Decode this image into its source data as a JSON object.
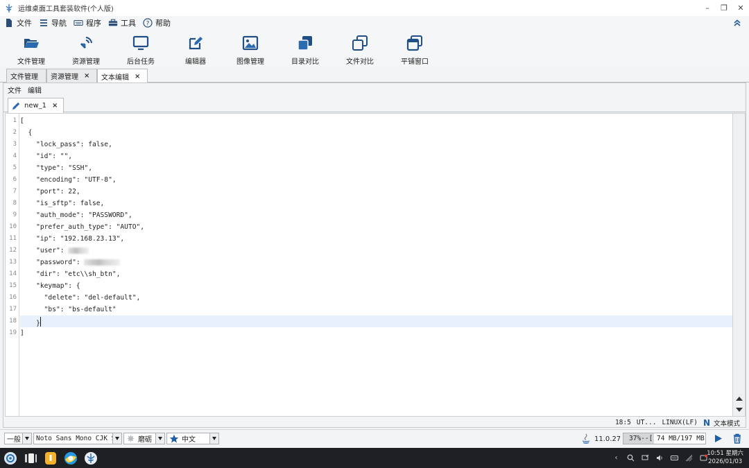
{
  "window": {
    "title": "运维桌面工具套装软件(个人版)"
  },
  "menu": [
    {
      "label": "文件",
      "icon": "file-icon"
    },
    {
      "label": "导航",
      "icon": "list-icon"
    },
    {
      "label": "程序",
      "icon": "keyboard-icon"
    },
    {
      "label": "工具",
      "icon": "toolbox-icon"
    },
    {
      "label": "帮助",
      "icon": "help-icon"
    }
  ],
  "toolbar": [
    {
      "label": "文件管理",
      "icon": "folder-open-icon"
    },
    {
      "label": "资源管理",
      "icon": "satellite-icon"
    },
    {
      "label": "后台任务",
      "icon": "monitor-icon"
    },
    {
      "label": "编辑器",
      "icon": "edit-icon"
    },
    {
      "label": "图像管理",
      "icon": "image-icon"
    },
    {
      "label": "目录对比",
      "icon": "copy-solid-icon"
    },
    {
      "label": "文件对比",
      "icon": "copy-outline-icon"
    },
    {
      "label": "平铺窗口",
      "icon": "windows-icon"
    }
  ],
  "main_tabs": [
    {
      "label": "文件管理",
      "closable": false
    },
    {
      "label": "资源管理",
      "closable": true,
      "close": "×"
    },
    {
      "label": "文本编辑",
      "closable": true,
      "close": "×",
      "active": true
    }
  ],
  "editor_panel": {
    "menu": [
      "文件",
      "编辑"
    ],
    "file_tab": {
      "label": "new_1",
      "close": "×",
      "icon": "pencil-icon"
    },
    "lines": [
      {
        "n": "1",
        "text": "["
      },
      {
        "n": "2",
        "text": "  {"
      },
      {
        "n": "3",
        "text": "    \"lock_pass\": false,"
      },
      {
        "n": "4",
        "text": "    \"id\": \"\","
      },
      {
        "n": "5",
        "text": "    \"type\": \"SSH\","
      },
      {
        "n": "6",
        "text": "    \"encoding\": \"UTF-8\","
      },
      {
        "n": "7",
        "text": "    \"port\": 22,"
      },
      {
        "n": "8",
        "text": "    \"is_sftp\": false,"
      },
      {
        "n": "9",
        "text": "    \"auth_mode\": \"PASSWORD\","
      },
      {
        "n": "10",
        "text": "    \"prefer_auth_type\": \"AUTO\","
      },
      {
        "n": "11",
        "text": "    \"ip\": \"192.168.23.13\","
      },
      {
        "n": "12",
        "text": "    \"user\": ",
        "redacted": true
      },
      {
        "n": "13",
        "text": "    \"password\": ",
        "redacted": true
      },
      {
        "n": "14",
        "text": "    \"dir\": \"etc\\\\sh_btn\","
      },
      {
        "n": "15",
        "text": "    \"keymap\": {"
      },
      {
        "n": "16",
        "text": "      \"delete\": \"del-default\","
      },
      {
        "n": "17",
        "text": "      \"bs\": \"bs-default\""
      },
      {
        "n": "18",
        "text": "    }",
        "current": true
      },
      {
        "n": "19",
        "text": "]"
      }
    ],
    "status": {
      "position": "18:5",
      "encoding": "UT...",
      "line_ending": "LINUX(LF)",
      "mode_icon": "N",
      "mode": "文本模式"
    }
  },
  "statusbar": {
    "category": "一般",
    "font": "Noto Sans Mono CJK SC",
    "theme": "磨砺",
    "language": "中文",
    "java_version": "11.0.27",
    "memory_text": "37%--[ 74 MB/197 MB ]",
    "memory_percent": 37
  },
  "taskbar": {
    "clock_time": "10:51 星期六",
    "clock_date": "2026/01/03",
    "colors": {
      "background": "#1f2023"
    }
  }
}
